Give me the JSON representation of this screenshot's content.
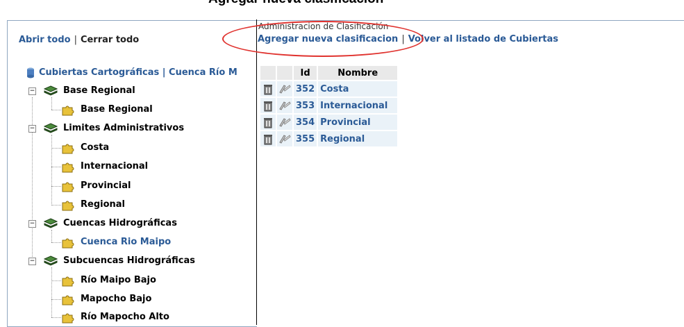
{
  "page_title": "Agregar nueva clasificacion",
  "left_panel": {
    "open_all": "Abrir todo",
    "separator": "|",
    "close_all": "Cerrar todo",
    "root": "Cubiertas Cartográficas | Cuenca Río M",
    "groups": [
      {
        "label": "Base Regional",
        "children": [
          "Base Regional"
        ]
      },
      {
        "label": "Limites Administrativos",
        "children": [
          "Costa",
          "Internacional",
          "Provincial",
          "Regional"
        ]
      },
      {
        "label": "Cuencas Hidrográficas",
        "children": [
          "Cuenca Rio Maipo"
        ]
      },
      {
        "label": "Subcuencas Hidrográficas",
        "children": [
          "Río Maipo Bajo",
          "Mapocho Bajo",
          "Río Mapocho Alto"
        ]
      }
    ],
    "active_leaf": "Cuenca Rio Maipo"
  },
  "right_panel": {
    "admin_title": "Administracion de Clasificación",
    "add_link": "Agregar nueva clasificacion",
    "separator": "|",
    "back_link": "Volver al listado de Cubiertas",
    "table": {
      "headers": [
        "",
        "",
        "Id",
        "Nombre"
      ],
      "rows": [
        {
          "id": "352",
          "name": "Costa"
        },
        {
          "id": "353",
          "name": "Internacional"
        },
        {
          "id": "354",
          "name": "Provincial"
        },
        {
          "id": "355",
          "name": "Regional"
        }
      ]
    }
  },
  "colors": {
    "link": "#2a5a96",
    "highlight": "#e0322e",
    "row_bg": "#eaf2f8",
    "header_bg": "#e9e9e9"
  },
  "icons": [
    "database-icon",
    "expander-minus-icon",
    "layers-icon",
    "puzzle-icon",
    "trash-icon",
    "edit-icon"
  ]
}
